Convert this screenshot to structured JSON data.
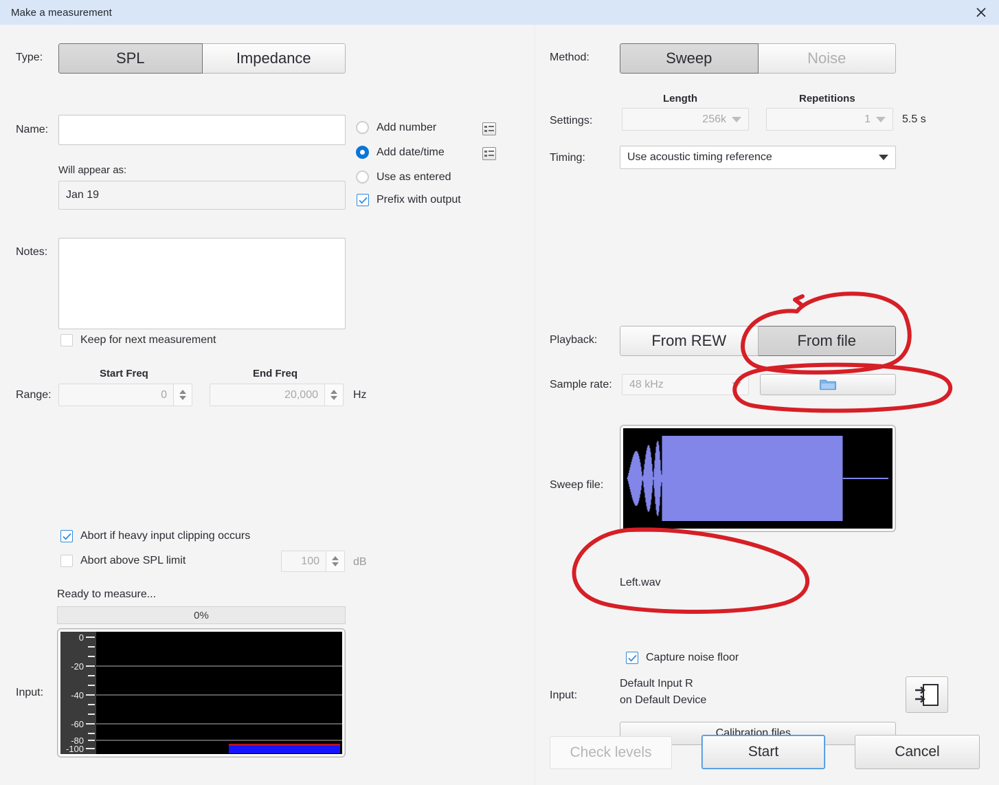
{
  "window": {
    "title": "Make a measurement",
    "close_icon": "close-icon"
  },
  "left": {
    "type_label": "Type:",
    "type_options": [
      "SPL",
      "Impedance"
    ],
    "type_selected": "SPL",
    "name_label": "Name:",
    "name_value": "",
    "will_appear_label": "Will appear as:",
    "will_appear_value": "Jan 19",
    "naming_options": [
      {
        "label": "Add number",
        "selected": false,
        "has_icon": true
      },
      {
        "label": "Add date/time",
        "selected": true,
        "has_icon": true
      },
      {
        "label": "Use as entered",
        "selected": false,
        "has_icon": false
      }
    ],
    "prefix_with_output": {
      "label": "Prefix with output",
      "checked": true
    },
    "notes_label": "Notes:",
    "notes_value": "",
    "keep_for_next": {
      "label": "Keep for next measurement",
      "checked": false
    },
    "range_label": "Range:",
    "start_freq_header": "Start Freq",
    "end_freq_header": "End Freq",
    "start_freq_value": "0",
    "end_freq_value": "20,000",
    "freq_unit": "Hz",
    "abort_clipping": {
      "label": "Abort if heavy input clipping occurs",
      "checked": true
    },
    "abort_spl": {
      "label": "Abort above SPL limit",
      "checked": false
    },
    "spl_limit_value": "100",
    "spl_unit": "dB",
    "status_text": "Ready to measure...",
    "progress_text": "0%",
    "progress_percent": 0,
    "input_label": "Input:",
    "meter_ticks": [
      "0",
      "-20",
      "-40",
      "-60",
      "-80",
      "-100"
    ]
  },
  "right": {
    "method_label": "Method:",
    "method_options": [
      "Sweep",
      "Noise"
    ],
    "method_selected": "Sweep",
    "method_disabled": "Noise",
    "settings_label": "Settings:",
    "length_header": "Length",
    "repetitions_header": "Repetitions",
    "length_value": "256k",
    "repetitions_value": "1",
    "duration_value": "5.5 s",
    "timing_label": "Timing:",
    "timing_value": "Use acoustic timing reference",
    "playback_label": "Playback:",
    "playback_options": [
      "From REW",
      "From file"
    ],
    "playback_selected": "From file",
    "sample_rate_label": "Sample rate:",
    "sample_rate_value": "48 kHz",
    "browse_icon": "folder-icon",
    "sweep_file_label": "Sweep file:",
    "sweep_file_name": "Left.wav",
    "capture_noise_floor": {
      "label": "Capture noise floor",
      "checked": true
    },
    "input_label": "Input:",
    "input_line1": "Default Input R",
    "input_line2": "on Default Device",
    "input_select_icon": "input-routing-icon",
    "calibration_button": "Calibration files...",
    "check_levels_button": "Check levels",
    "start_button": "Start",
    "cancel_button": "Cancel"
  },
  "colors": {
    "titlebar": "#d9e6f8",
    "accent_blue": "#0a76d8",
    "annotation_red": "#d61f26",
    "waveform_blue": "#8186e8",
    "meter_level_blue": "#1414ff",
    "meter_peak_red": "#c01018"
  }
}
